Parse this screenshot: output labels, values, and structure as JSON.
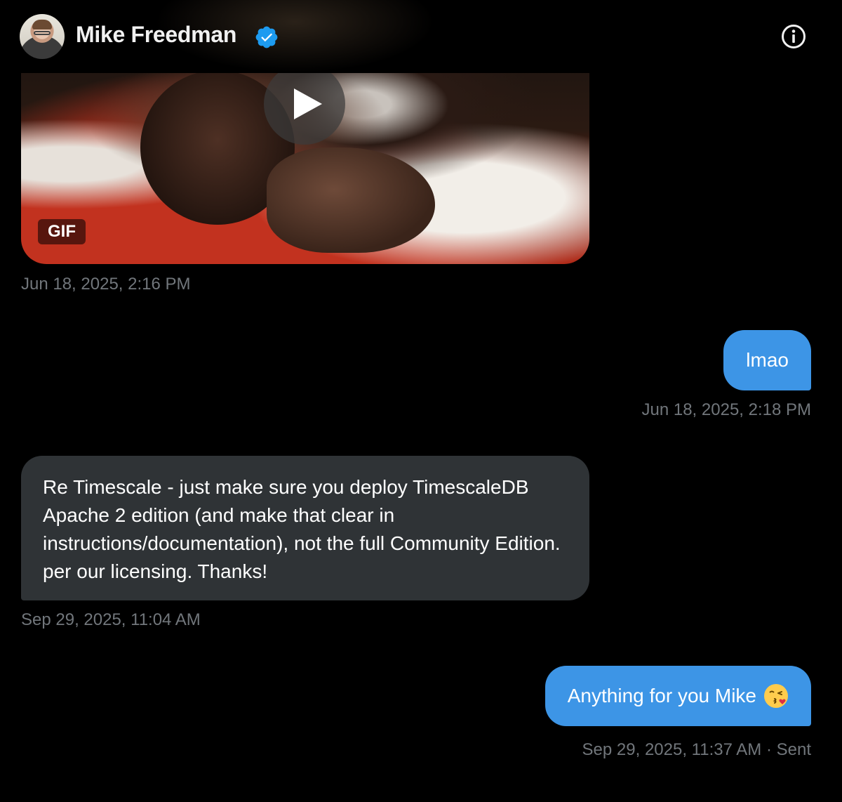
{
  "header": {
    "contact_name": "Mike Freedman",
    "verified": true,
    "icons": {
      "verified": "verified-badge-icon",
      "info": "info-icon"
    }
  },
  "messages": [
    {
      "type": "media",
      "direction": "received",
      "media_badge": "GIF",
      "timestamp": "Jun 18, 2025, 2:16 PM"
    },
    {
      "type": "text",
      "direction": "sent",
      "text": "lmao",
      "timestamp": "Jun 18, 2025, 2:18 PM"
    },
    {
      "type": "text",
      "direction": "received",
      "text": "Re Timescale - just make sure you deploy TimescaleDB Apache 2 edition (and make that clear in instructions/documentation), not the full Community Edition. per our licensing. Thanks!",
      "timestamp": "Sep 29, 2025, 11:04 AM"
    },
    {
      "type": "text",
      "direction": "sent",
      "text": "Anything for you Mike",
      "emoji": "kissing-face-icon",
      "timestamp": "Sep 29, 2025, 11:37 AM · Sent"
    }
  ],
  "colors": {
    "background": "#000000",
    "sent_bubble": "#3d95e6",
    "received_bubble": "#2f3336",
    "timestamp": "#71767b",
    "verified": "#1d9bf0"
  }
}
